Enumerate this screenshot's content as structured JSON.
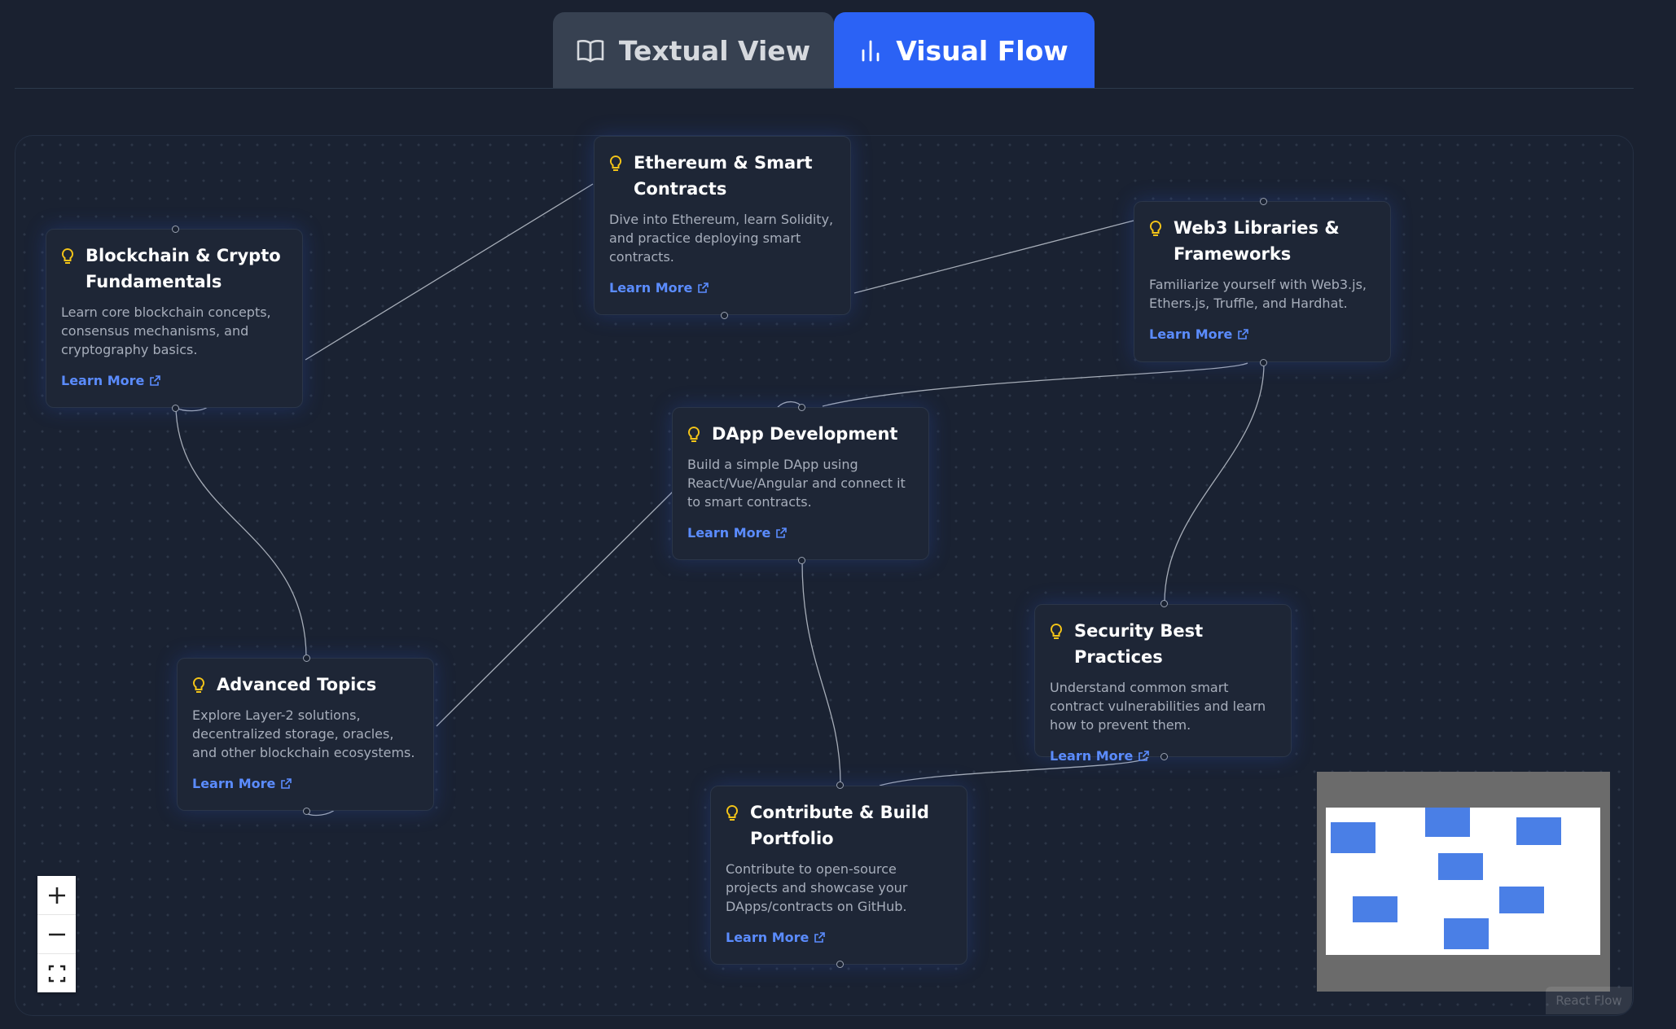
{
  "tabs": {
    "textual": {
      "label": "Textual View",
      "icon": "book-open-icon"
    },
    "visual": {
      "label": "Visual Flow",
      "icon": "bar-chart-icon",
      "active": true
    }
  },
  "nodes": [
    {
      "id": "blockchain",
      "title": "Blockchain & Crypto Fundamentals",
      "description": "Learn core blockchain concepts, consensus mechanisms, and cryptography basics.",
      "link": "Learn More"
    },
    {
      "id": "ethereum",
      "title": "Ethereum & Smart Contracts",
      "description": "Dive into Ethereum, learn Solidity, and practice deploying smart contracts.",
      "link": "Learn More"
    },
    {
      "id": "web3libs",
      "title": "Web3 Libraries & Frameworks",
      "description": "Familiarize yourself with Web3.js, Ethers.js, Truffle, and Hardhat.",
      "link": "Learn More"
    },
    {
      "id": "dapp",
      "title": "DApp Development",
      "description": "Build a simple DApp using React/Vue/Angular and connect it to smart contracts.",
      "link": "Learn More"
    },
    {
      "id": "advanced",
      "title": "Advanced Topics",
      "description": "Explore Layer-2 solutions, decentralized storage, oracles, and other blockchain ecosystems.",
      "link": "Learn More"
    },
    {
      "id": "security",
      "title": "Security Best Practices",
      "description": "Understand common smart contract vulnerabilities and learn how to prevent them.",
      "link": "Learn More"
    },
    {
      "id": "contribute",
      "title": "Contribute & Build Portfolio",
      "description": "Contribute to open-source projects and showcase your DApps/contracts on GitHub.",
      "link": "Learn More"
    }
  ],
  "controls": {
    "zoom_in_icon": "plus-icon",
    "zoom_out_icon": "minus-icon",
    "fit_view_icon": "fit-view-icon"
  },
  "attribution": "React Flow",
  "colors": {
    "accent": "#2b62f5",
    "link": "#5b8cff",
    "bulb": "#f5c518",
    "minimap_node": "#4a7fe6"
  }
}
